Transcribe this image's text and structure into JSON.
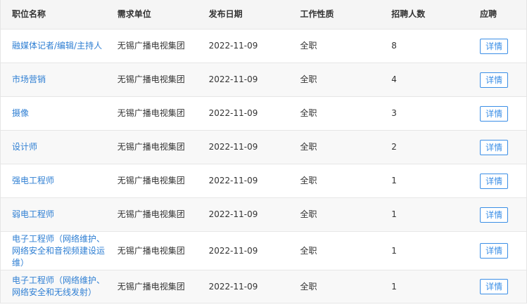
{
  "table": {
    "headers": {
      "title": "职位名称",
      "unit": "需求单位",
      "date": "发布日期",
      "type": "工作性质",
      "count": "招聘人数",
      "apply": "应聘"
    },
    "rows": [
      {
        "title": "融媒体记者/编辑/主持人",
        "unit": "无锡广播电视集团",
        "date": "2022-11-09",
        "type": "全职",
        "count": "8",
        "action": "详情"
      },
      {
        "title": "市场营销",
        "unit": "无锡广播电视集团",
        "date": "2022-11-09",
        "type": "全职",
        "count": "4",
        "action": "详情"
      },
      {
        "title": "摄像",
        "unit": "无锡广播电视集团",
        "date": "2022-11-09",
        "type": "全职",
        "count": "3",
        "action": "详情"
      },
      {
        "title": "设计师",
        "unit": "无锡广播电视集团",
        "date": "2022-11-09",
        "type": "全职",
        "count": "2",
        "action": "详情"
      },
      {
        "title": "强电工程师",
        "unit": "无锡广播电视集团",
        "date": "2022-11-09",
        "type": "全职",
        "count": "1",
        "action": "详情"
      },
      {
        "title": "弱电工程师",
        "unit": "无锡广播电视集团",
        "date": "2022-11-09",
        "type": "全职",
        "count": "1",
        "action": "详情"
      },
      {
        "title": "电子工程师（网络维护、网络安全和音视频建设运维）",
        "unit": "无锡广播电视集团",
        "date": "2022-11-09",
        "type": "全职",
        "count": "1",
        "action": "详情"
      },
      {
        "title": "电子工程师（网络维护、网络安全和无线发射）",
        "unit": "无锡广播电视集团",
        "date": "2022-11-09",
        "type": "全职",
        "count": "1",
        "action": "详情"
      }
    ],
    "colors": {
      "link": "#2f7fd3",
      "button": "#3a8ee6",
      "header_bg": "#f5f5f5",
      "stripe_bg": "#f8f8f8"
    }
  }
}
